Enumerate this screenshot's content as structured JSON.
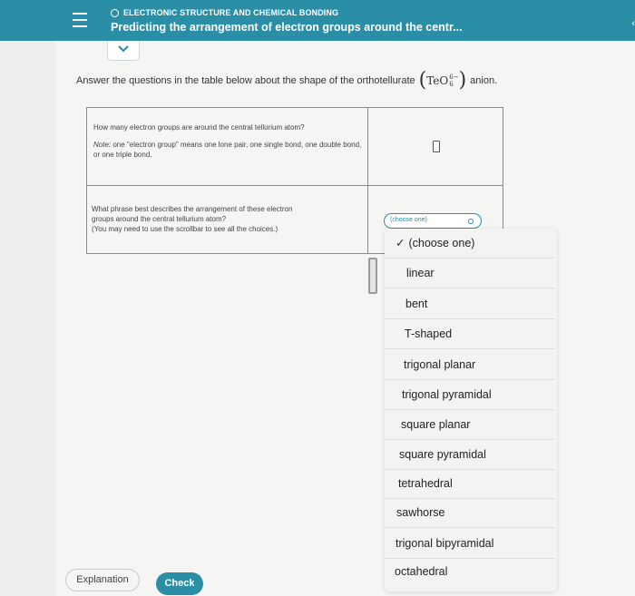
{
  "header": {
    "topic": "ELECTRONIC STRUCTURE AND CHEMICAL BONDING",
    "title": "Predicting the arrangement of electron groups around the centr...",
    "right_chevron": "‹"
  },
  "prompt": {
    "before": "Answer the questions in the table below about the shape of the orthotellurate",
    "formula_base": "TeO",
    "formula_charge": "6−",
    "formula_subscript": "6",
    "after": "anion."
  },
  "questions": {
    "q1_main": "How many electron groups are around the central tellurium atom?",
    "q1_note_label": "Note:",
    "q1_note_text": " one \"electron group\" means one lone pair, one single bond, one double bond, or one triple bond.",
    "q2_line1": "What phrase best describes the arrangement of these electron",
    "q2_line2": "groups around the central tellurium atom?",
    "q2_line3": "(You may need to use the scrollbar to see all the choices.)"
  },
  "select": {
    "value": "(choose one)"
  },
  "dropdown": {
    "selected_mark": "✓",
    "options": [
      "(choose one)",
      "linear",
      "bent",
      "T-shaped",
      "trigonal planar",
      "trigonal pyramidal",
      "square planar",
      "square pyramidal",
      "tetrahedral",
      "sawhorse",
      "trigonal bipyramidal",
      "octahedral"
    ]
  },
  "footer": {
    "explanation": "Explanation",
    "check": "Check"
  },
  "colors": {
    "accent": "#2a8ea6"
  }
}
